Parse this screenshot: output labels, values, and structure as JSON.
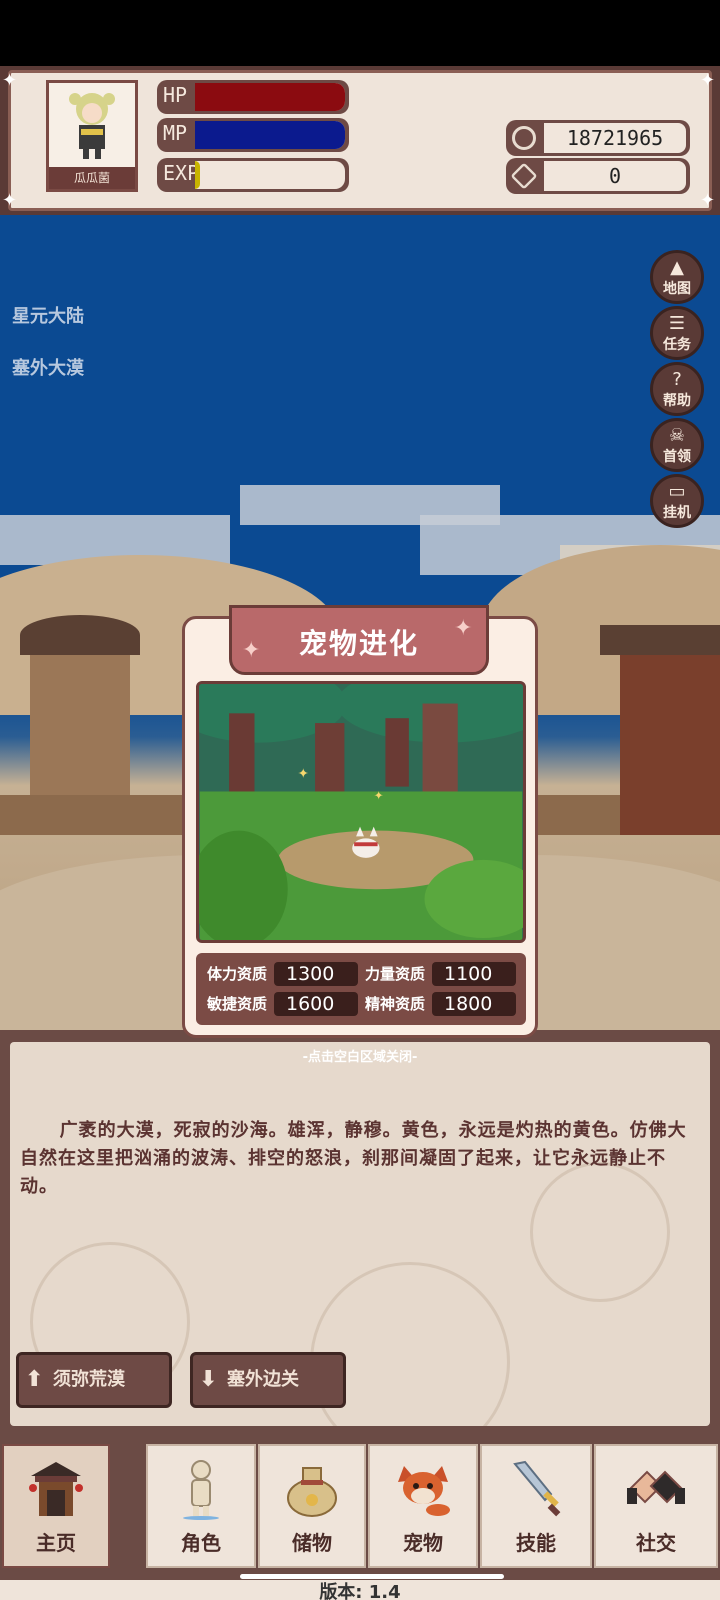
{
  "player": {
    "name": "瓜瓜菌",
    "bars": [
      {
        "label": "HP",
        "fill": 1.0,
        "color": "#8b0b10"
      },
      {
        "label": "MP",
        "fill": 1.0,
        "color": "#0b1a8e"
      },
      {
        "label": "EXP",
        "fill": 0.03,
        "color": "#c8b400"
      }
    ]
  },
  "currency": {
    "coins": "18721965",
    "gems": "0"
  },
  "location": {
    "region": "星元大陆",
    "area": "塞外大漠"
  },
  "side_menu": [
    {
      "label": "地图",
      "icon": "mountain-icon"
    },
    {
      "label": "任务",
      "icon": "scroll-icon"
    },
    {
      "label": "帮助",
      "icon": "question-icon"
    },
    {
      "label": "首领",
      "icon": "boss-icon"
    },
    {
      "label": "挂机",
      "icon": "monitor-icon"
    }
  ],
  "modal": {
    "title": "宠物进化",
    "stats": [
      {
        "name": "体力资质",
        "value": "1300"
      },
      {
        "name": "力量资质",
        "value": "1100"
      },
      {
        "name": "敏捷资质",
        "value": "1600"
      },
      {
        "name": "精神资质",
        "value": "1800"
      }
    ],
    "close_hint": "-点击空白区域关闭-"
  },
  "description": "广袤的大漠，死寂的沙海。雄浑，静穆。黄色，永远是灼热的黄色。仿佛大自然在这里把汹涌的波涛、排空的怒浪，刹那间凝固了起来，让它永远静止不动。",
  "routes": [
    {
      "label": "须弥荒漠",
      "direction": "up"
    },
    {
      "label": "塞外边关",
      "direction": "down"
    }
  ],
  "nav": [
    {
      "label": "主页",
      "icon": "gate-icon",
      "active": true
    },
    {
      "label": "角色",
      "icon": "character-icon",
      "active": false
    },
    {
      "label": "储物",
      "icon": "bag-icon",
      "active": false
    },
    {
      "label": "宠物",
      "icon": "fox-icon",
      "active": false
    },
    {
      "label": "技能",
      "icon": "sword-icon",
      "active": false
    },
    {
      "label": "社交",
      "icon": "handshake-icon",
      "active": false
    }
  ],
  "version": "版本: 1.4",
  "colors": {
    "frame": "#6b4b45",
    "panel": "#e6d9cc",
    "sky": "#0b4a92",
    "modal_title": "#b9696a"
  }
}
